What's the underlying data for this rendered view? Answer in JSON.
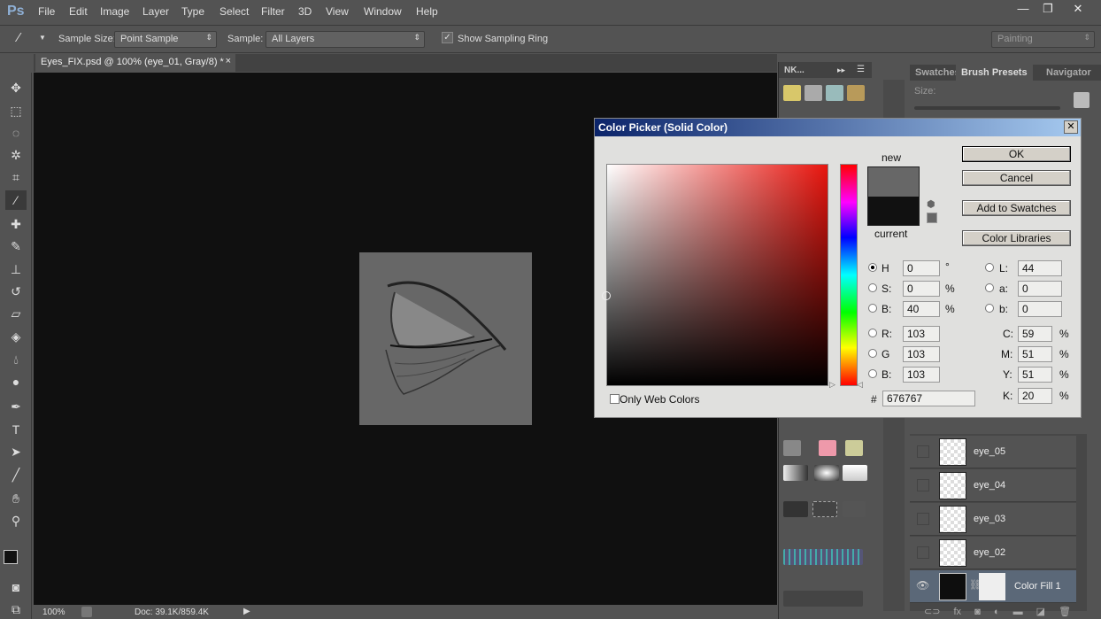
{
  "app": {
    "logo": "Ps"
  },
  "menu": [
    "File",
    "Edit",
    "Image",
    "Layer",
    "Type",
    "Select",
    "Filter",
    "3D",
    "View",
    "Window",
    "Help"
  ],
  "window_buttons": [
    "—",
    "❐",
    "✕"
  ],
  "options": {
    "sample_size_label": "Sample Size:",
    "sample_size_value": "Point Sample",
    "sample_label": "Sample:",
    "sample_value": "All Layers",
    "show_ring_label": "Show Sampling Ring",
    "show_ring_checked": true,
    "workspace": "Painting"
  },
  "document": {
    "tab_title": "Eyes_FIX.psd @ 100% (eye_01, Gray/8) *",
    "close": "×",
    "zoom": "100%",
    "doc_info": "Doc: 39.1K/859.4K"
  },
  "mid_panel": {
    "title": "NK..."
  },
  "right_panel": {
    "tabs": [
      "Swatches",
      "Brush Presets",
      "Navigator"
    ],
    "active_tab": "Brush Presets",
    "size_label": "Size:"
  },
  "layers": [
    {
      "name": "eye_05",
      "visible": false
    },
    {
      "name": "eye_04",
      "visible": false
    },
    {
      "name": "eye_03",
      "visible": false
    },
    {
      "name": "eye_02",
      "visible": false
    },
    {
      "name": "Color Fill 1",
      "visible": true,
      "selected": true
    }
  ],
  "color_picker": {
    "title": "Color Picker (Solid Color)",
    "close": "✕",
    "new_label": "new",
    "current_label": "current",
    "new_color": "#676767",
    "current_color": "#111111",
    "buttons": {
      "ok": "OK",
      "cancel": "Cancel",
      "add_swatches": "Add to Swatches",
      "libraries": "Color Libraries"
    },
    "only_web_label": "Only Web Colors",
    "fields": {
      "H": {
        "label": "H",
        "value": "0",
        "unit": "°",
        "selected": true
      },
      "S": {
        "label": "S:",
        "value": "0",
        "unit": "%"
      },
      "B": {
        "label": "B:",
        "value": "40",
        "unit": "%"
      },
      "R": {
        "label": "R:",
        "value": "103"
      },
      "G": {
        "label": "G",
        "value": "103"
      },
      "Bl": {
        "label": "B:",
        "value": "103"
      },
      "L": {
        "label": "L:",
        "value": "44"
      },
      "a": {
        "label": "a:",
        "value": "0"
      },
      "b": {
        "label": "b:",
        "value": "0"
      },
      "C": {
        "label": "C:",
        "value": "59",
        "unit": "%"
      },
      "M": {
        "label": "M:",
        "value": "51",
        "unit": "%"
      },
      "Y": {
        "label": "Y:",
        "value": "51",
        "unit": "%"
      },
      "K": {
        "label": "K:",
        "value": "20",
        "unit": "%"
      }
    },
    "hex_label": "#",
    "hex": "676767"
  }
}
